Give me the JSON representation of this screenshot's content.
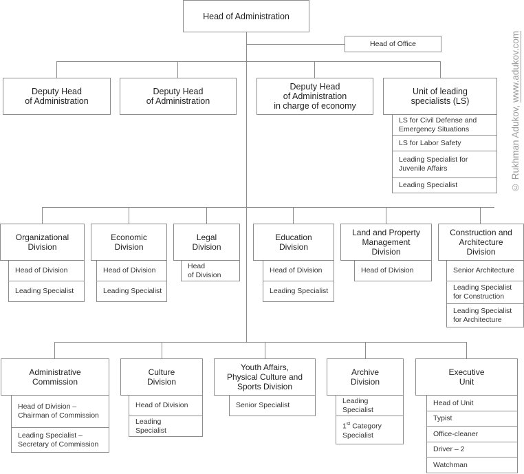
{
  "head": {
    "label": "Head of Administration"
  },
  "head_of_office": {
    "label": "Head of Office"
  },
  "deputies": [
    {
      "label": "Deputy Head\nof Administration"
    },
    {
      "label": "Deputy Head\nof Administration"
    },
    {
      "label": "Deputy Head\nof Administration\nin charge of economy"
    }
  ],
  "ls_unit": {
    "label": "Unit of leading\nspecialists (LS)",
    "items": [
      "LS for Civil Defense and\nEmergency Situations",
      "LS for Labor Safety",
      "Leading Specialist for\nJuvenile Affairs",
      "Leading Specialist"
    ]
  },
  "row2": [
    {
      "label": "Organizational\nDivision",
      "items": [
        "Head of Division",
        "Leading Specialist"
      ]
    },
    {
      "label": "Economic\nDivision",
      "items": [
        "Head of Division",
        "Leading Specialist"
      ]
    },
    {
      "label": "Legal\nDivision",
      "items": [
        "Head\nof Division"
      ]
    },
    {
      "label": "Education\nDivision",
      "items": [
        "Head of Division",
        "Leading Specialist"
      ]
    },
    {
      "label": "Land and Property\nManagement\nDivision",
      "items": [
        "Head of Division"
      ]
    },
    {
      "label": "Construction and\nArchitecture\nDivision",
      "items": [
        "Senior Architecture",
        "Leading Specialist\nfor Construction",
        "Leading Specialist\nfor Architecture"
      ]
    }
  ],
  "row3": [
    {
      "label": "Administrative\nCommission",
      "items": [
        "Head of Division –\nChairman of Commission",
        "Leading Specialist –\nSecretary of Commission"
      ]
    },
    {
      "label": "Culture\nDivision",
      "items": [
        "Head of Division",
        "Leading\nSpecialist"
      ]
    },
    {
      "label": "Youth Affairs,\nPhysical Culture and\nSports Division",
      "items": [
        "Senior Specialist"
      ]
    },
    {
      "label": "Archive\nDivision",
      "items": [
        "Leading\nSpecialist",
        "1st Category\nSpecialist"
      ]
    },
    {
      "label": "Executive\nUnit",
      "items": [
        "Head of Unit",
        "Typist",
        "Office-cleaner",
        "Driver – 2",
        "Watchman"
      ]
    }
  ],
  "watermark": {
    "text": "© Rukhman Adukov, ",
    "link": "www.adukov.com"
  }
}
